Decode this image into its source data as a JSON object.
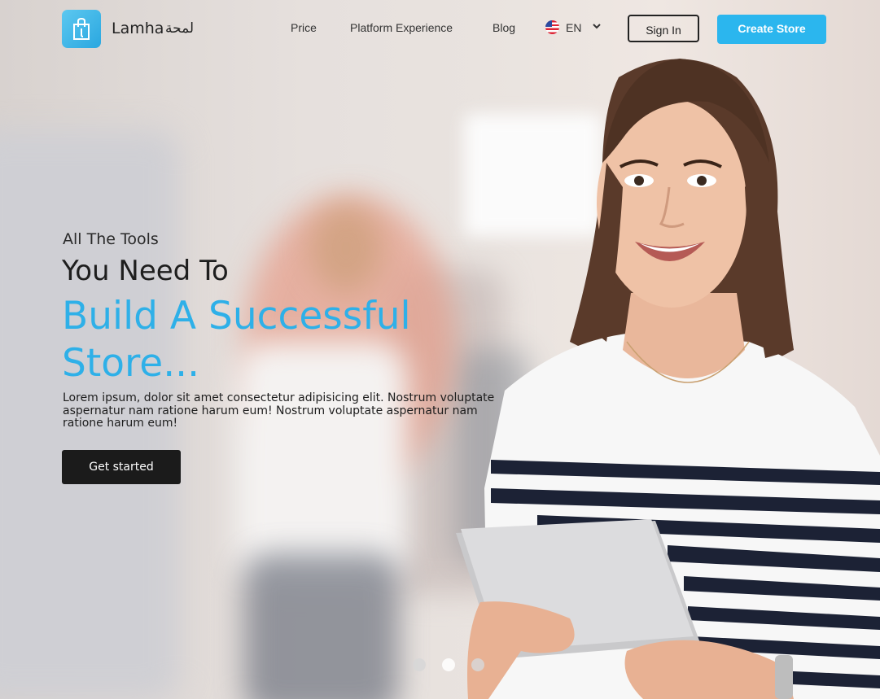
{
  "header": {
    "brand_name": "Lamha",
    "brand_name_ar": "لمحة",
    "nav": [
      {
        "label": "Price"
      },
      {
        "label": "Platform Experience"
      },
      {
        "label": "Blog"
      }
    ],
    "language": {
      "code": "EN",
      "flag_icon": "us-flag-icon"
    },
    "signin_label": "Sign In",
    "create_store_label": "Create Store"
  },
  "hero": {
    "line1": "All The Tools",
    "line2": "You Need To",
    "line3": "Build A Successful Store...",
    "paragraph": "Lorem ipsum, dolor sit amet consectetur adipisicing elit. Nostrum voluptate aspernatur nam ratione harum eum! Nostrum voluptate aspernatur nam ratione harum eum!",
    "cta_label": "Get started"
  },
  "carousel": {
    "slides": 3,
    "active_index": 1
  },
  "colors": {
    "accent": "#2bb6ee",
    "dark": "#1b1b1b"
  }
}
